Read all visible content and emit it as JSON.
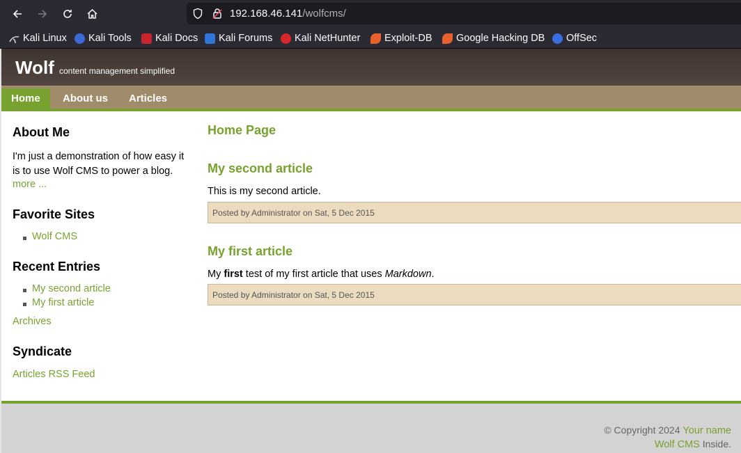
{
  "browser": {
    "url_host": "192.168.46.141",
    "url_path": "/wolfcms/",
    "bookmarks": [
      {
        "label": "Kali Linux",
        "icon": "kali-dragon-icon"
      },
      {
        "label": "Kali Tools",
        "icon": "kali-tools-icon"
      },
      {
        "label": "Kali Docs",
        "icon": "kali-docs-icon"
      },
      {
        "label": "Kali Forums",
        "icon": "kali-forums-icon"
      },
      {
        "label": "Kali NetHunter",
        "icon": "kali-nethunter-icon"
      },
      {
        "label": "Exploit-DB",
        "icon": "exploit-db-icon"
      },
      {
        "label": "Google Hacking DB",
        "icon": "ghdb-icon"
      },
      {
        "label": "OffSec",
        "icon": "offsec-icon"
      }
    ]
  },
  "site": {
    "title": "Wolf",
    "slogan": "content management simplified",
    "menu": [
      "Home",
      "About us",
      "Articles"
    ]
  },
  "sidebar": {
    "about_heading": "About Me",
    "about_text": "I'm just a demonstration of how easy it is to use Wolf CMS to power a blog.",
    "more_link": "more ...",
    "favorites_heading": "Favorite Sites",
    "favorites": [
      "Wolf CMS"
    ],
    "recent_heading": "Recent Entries",
    "recent": [
      "My second article",
      "My first article"
    ],
    "archives_link": "Archives",
    "syndicate_heading": "Syndicate",
    "rss_link": "Articles RSS Feed"
  },
  "content": {
    "page_title": "Home Page",
    "articles": [
      {
        "title": "My second article",
        "body": "This is my second article.",
        "posted": "Posted by Administrator on Sat, 5 Dec 2015"
      },
      {
        "title": "My first article",
        "body_prefix": "My ",
        "body_bold": "first",
        "body_mid": " test of my first article that uses ",
        "body_em": "Markdown",
        "body_suffix": ".",
        "posted": "Posted by Administrator on Sat, 5 Dec 2015"
      }
    ]
  },
  "footer": {
    "copyright": "© Copyright 2024",
    "your_name": "Your name",
    "wolf_cms": "Wolf CMS",
    "inside": "Inside."
  },
  "colors": {
    "accent_green": "#78a22f",
    "menu_tan": "#a08c6a",
    "header_brown": "#4b3f37",
    "posted_bg": "#ecdcbf"
  }
}
